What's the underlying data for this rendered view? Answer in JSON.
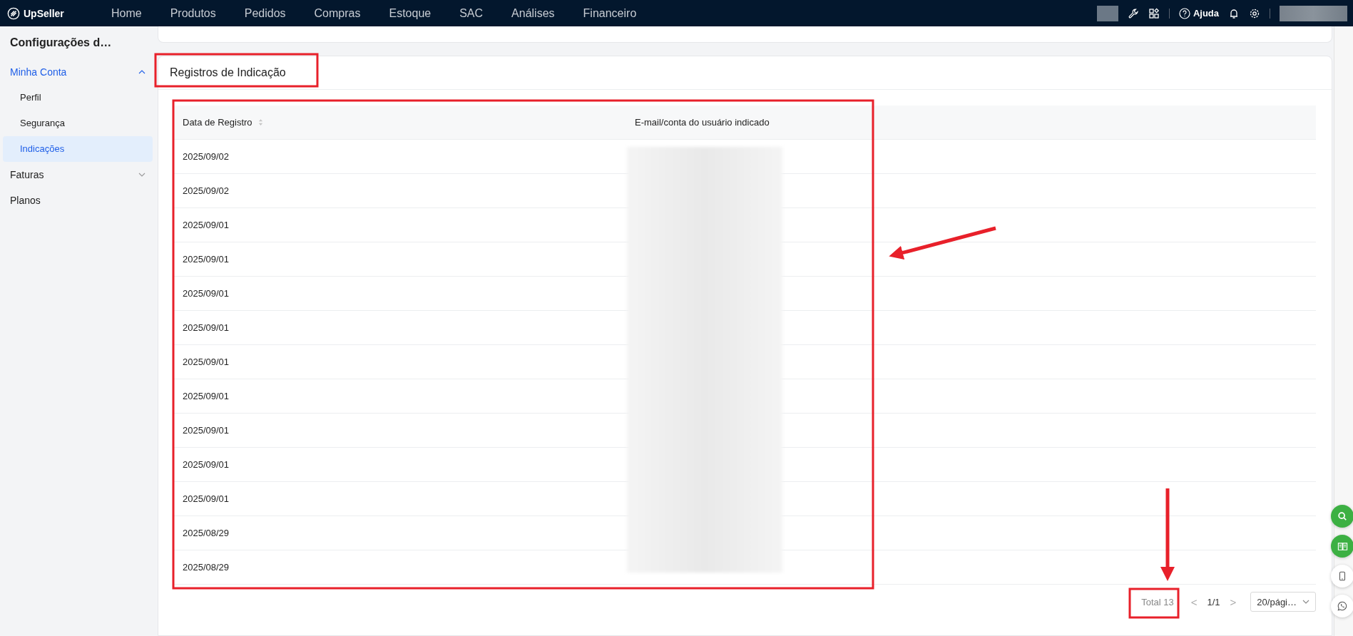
{
  "topbar": {
    "brand": "UpSeller",
    "nav": [
      "Home",
      "Produtos",
      "Pedidos",
      "Compras",
      "Estoque",
      "SAC",
      "Análises",
      "Financeiro"
    ],
    "help": "Ajuda"
  },
  "sidebar": {
    "title": "Configurações d…",
    "items": [
      {
        "label": "Minha Conta",
        "expanded": true,
        "children": [
          {
            "label": "Perfil",
            "selected": false
          },
          {
            "label": "Segurança",
            "selected": false
          },
          {
            "label": "Indicações",
            "selected": true
          }
        ]
      },
      {
        "label": "Faturas",
        "expanded": false
      },
      {
        "label": "Planos"
      }
    ]
  },
  "card": {
    "title": "Registros de Indicação"
  },
  "table": {
    "columns": [
      "Data de Registro",
      "E-mail/conta do usuário indicado"
    ],
    "rows": [
      "2025/09/02",
      "2025/09/02",
      "2025/09/01",
      "2025/09/01",
      "2025/09/01",
      "2025/09/01",
      "2025/09/01",
      "2025/09/01",
      "2025/09/01",
      "2025/09/01",
      "2025/09/01",
      "2025/08/29",
      "2025/08/29"
    ]
  },
  "pagination": {
    "total": "Total 13",
    "prev": "<",
    "page": "1/1",
    "next": ">",
    "page_size": "20/pági…"
  }
}
